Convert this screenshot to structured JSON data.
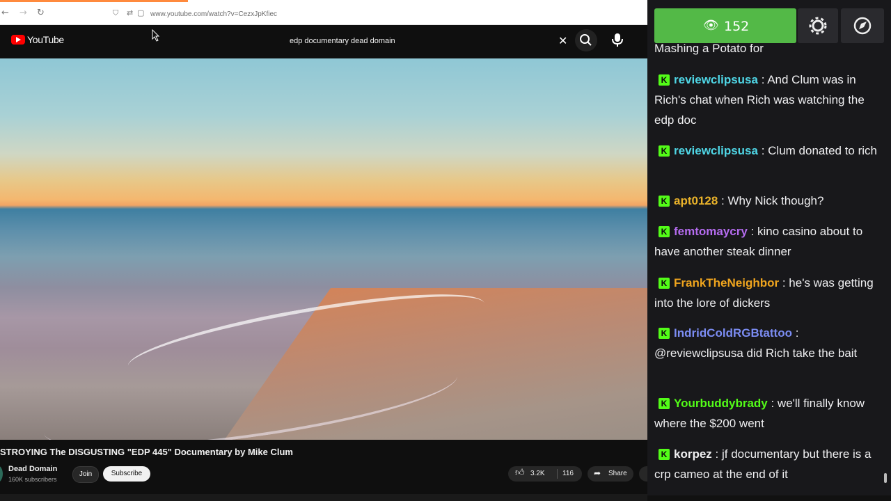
{
  "browser": {
    "url": "www.youtube.com/watch?v=CezxJpKfiec",
    "tab_accent": "#ff8a3d"
  },
  "youtube": {
    "logo_text": "YouTube",
    "search_value": "edp documentary dead domain",
    "video": {
      "title": "STROYING The DISGUSTING \"EDP 445\" Documentary by Mike Clum",
      "channel": "Dead Domain",
      "subscribers": "160K subscribers",
      "join_label": "Join",
      "subscribe_label": "Subscribe",
      "likes": "3.2K",
      "dislikes": "116",
      "share_label": "Share"
    }
  },
  "chat": {
    "viewer_count": "152",
    "viewer_bar_color": "#53b947",
    "partial_top_message": "Mashing a Potato for",
    "badge_letter": "K",
    "messages": [
      {
        "user": "reviewclipsusa",
        "color": "#4fd6e6",
        "text": "And Clum was in Rich's chat when Rich was watching the edp doc"
      },
      {
        "user": "reviewclipsusa",
        "color": "#4fd6e6",
        "text": "Clum donated to rich"
      },
      {
        "user": "apt0128",
        "color": "#e9b22a",
        "text": "Why Nick though?"
      },
      {
        "user": "femtomaycry",
        "color": "#b56cf0",
        "text": "kino casino about to have another steak dinner"
      },
      {
        "user": "FrankTheNeighbor",
        "color": "#f0a51e",
        "text": "he's was getting into the lore of dickers"
      },
      {
        "user": "IndridColdRGBtattoo",
        "color": "#7b8cf2",
        "text": "@reviewclipsusa did Rich take the bait"
      },
      {
        "user": "Yourbuddybrady",
        "color": "#53fc18",
        "text": "we'll finally know where the $200 went"
      },
      {
        "user": "korpez",
        "color": "#efeff1",
        "text": "jf documentary but there is a crp cameo at the end of it"
      }
    ]
  }
}
